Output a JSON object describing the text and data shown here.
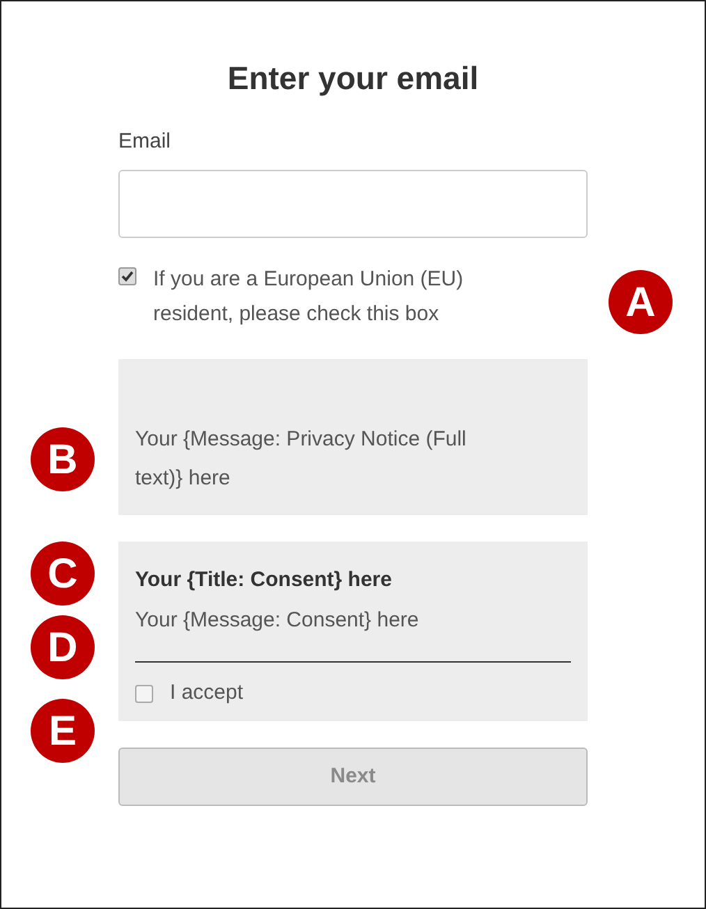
{
  "title": "Enter your email",
  "email": {
    "label": "Email"
  },
  "eu_check": {
    "label": "If you are a European Union (EU) resident, please check this box",
    "checked": true
  },
  "privacy_notice": "Your {Message: Privacy Notice (Full text)} here",
  "consent": {
    "title": "Your {Title: Consent} here",
    "message": "Your {Message: Consent} here",
    "accept": {
      "label": "I accept",
      "checked": false
    }
  },
  "next_button": {
    "label": "Next",
    "disabled": true
  },
  "callouts": [
    {
      "letter": "A"
    },
    {
      "letter": "B"
    },
    {
      "letter": "C"
    },
    {
      "letter": "D"
    },
    {
      "letter": "E"
    }
  ]
}
